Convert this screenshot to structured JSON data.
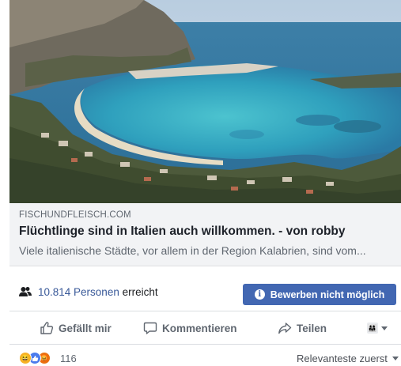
{
  "preview": {
    "domain": "FISCHUNDFLEISCH.COM",
    "headline": "Flüchtlinge sind in Italien auch willkommen. - von robby",
    "description": "Viele italienische Städte, vor allem in der Region Kalabrien, sind vom..."
  },
  "reach": {
    "count_link": "10.814 Personen",
    "suffix": "erreicht",
    "boost_label": "Bewerben nicht möglich"
  },
  "actions": {
    "like": "Gefällt mir",
    "comment": "Kommentieren",
    "share": "Teilen"
  },
  "reactions": {
    "count": "116",
    "sort_label": "Relevanteste zuerst"
  },
  "colors": {
    "accent": "#4267b2",
    "link": "#385898",
    "muted": "#606770"
  }
}
